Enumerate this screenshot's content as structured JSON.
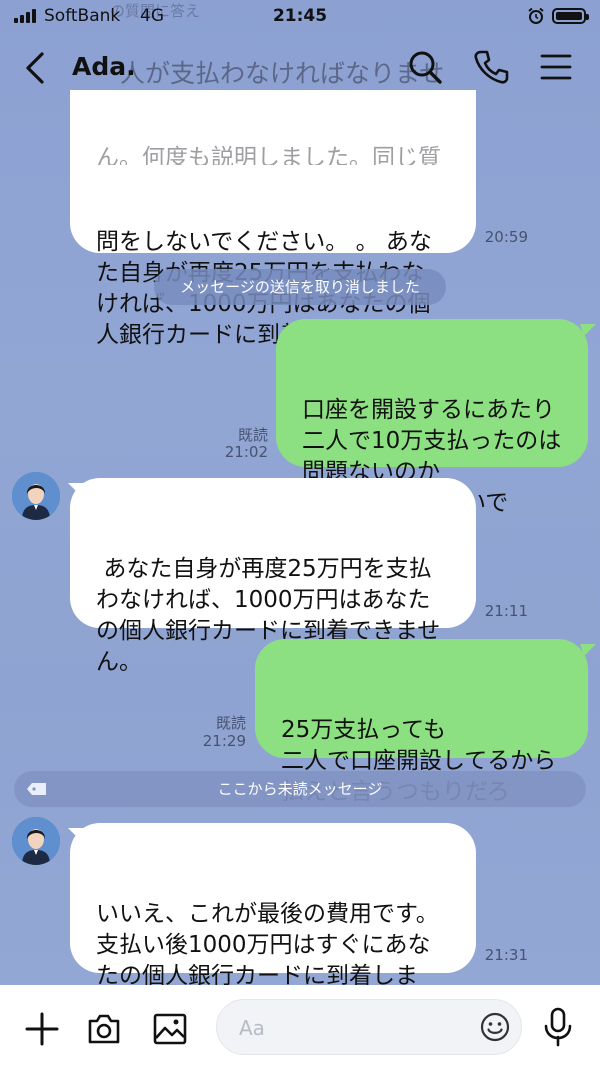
{
  "status_bar": {
    "carrier": "SoftBank",
    "network": "4G",
    "time": "21:45",
    "faded_preview": "の質問に答え"
  },
  "header": {
    "contact_name": "Ada.",
    "ghost_text": "人が支払わなければなりませ",
    "back_icon": "chevron-left-icon",
    "search_icon": "search-icon",
    "call_icon": "phone-icon",
    "menu_icon": "menu-icon"
  },
  "messages": [
    {
      "side": "left",
      "lines_faded": "ん。何度も説明しました。同じ質",
      "text": "問をしないでください。 。 あな\nた自身が再度25万円を支払わな\nければ、1000万円はあなたの個\n人銀行カードに到着できません。",
      "time": "20:59"
    },
    {
      "type": "system",
      "text": "メッセージの送信を取り消しました"
    },
    {
      "side": "right",
      "text": "口座を開設するにあたり\n二人で10万支払ったのは\n問題ないのか\n何回も聞かせないで",
      "read": "既読",
      "time": "21:02"
    },
    {
      "side": "left",
      "text": " あなた自身が再度25万円を支払\nわなければ、1000万円はあなた\nの個人銀行カードに到着できませ\nん。",
      "time": "21:11"
    },
    {
      "side": "right",
      "text": "25万支払っても\n二人で口座開設してるから\n払えと言うつもりだろ",
      "read": "既読",
      "time": "21:29"
    },
    {
      "type": "divider",
      "text": "ここから未読メッセージ"
    },
    {
      "side": "left",
      "text": "いいえ、これが最後の費用です。\n支払い後1000万円はすぐにあな\nたの個人銀行カードに到着しま\nす。",
      "time": "21:31"
    }
  ],
  "input_bar": {
    "placeholder": "Aa",
    "icons": [
      "plus-icon",
      "camera-icon",
      "image-icon",
      "emoji-icon",
      "microphone-icon"
    ]
  },
  "colors": {
    "chat_background": "#8ca1d2",
    "my_bubble": "#8de081",
    "their_bubble": "#ffffff"
  }
}
